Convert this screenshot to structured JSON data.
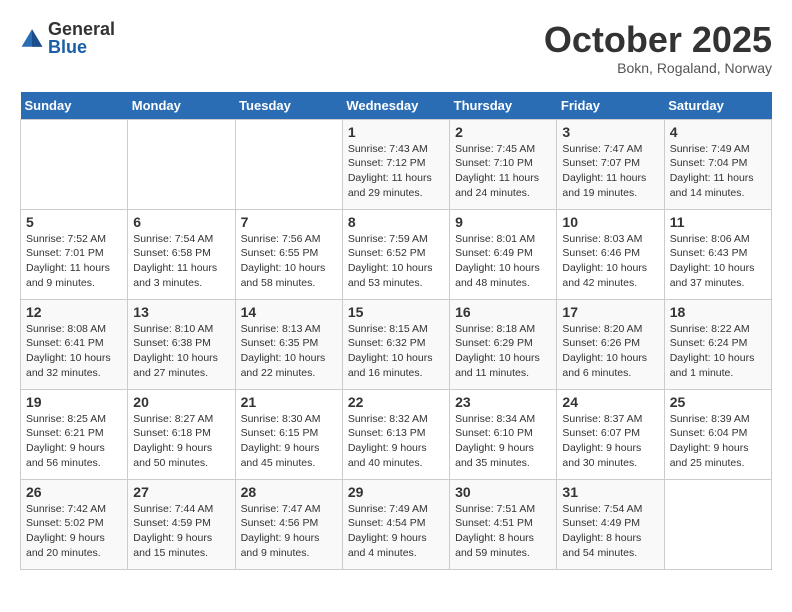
{
  "header": {
    "logo_general": "General",
    "logo_blue": "Blue",
    "month_year": "October 2025",
    "location": "Bokn, Rogaland, Norway"
  },
  "days_of_week": [
    "Sunday",
    "Monday",
    "Tuesday",
    "Wednesday",
    "Thursday",
    "Friday",
    "Saturday"
  ],
  "weeks": [
    [
      {
        "day": "",
        "info": ""
      },
      {
        "day": "",
        "info": ""
      },
      {
        "day": "",
        "info": ""
      },
      {
        "day": "1",
        "info": "Sunrise: 7:43 AM\nSunset: 7:12 PM\nDaylight: 11 hours\nand 29 minutes."
      },
      {
        "day": "2",
        "info": "Sunrise: 7:45 AM\nSunset: 7:10 PM\nDaylight: 11 hours\nand 24 minutes."
      },
      {
        "day": "3",
        "info": "Sunrise: 7:47 AM\nSunset: 7:07 PM\nDaylight: 11 hours\nand 19 minutes."
      },
      {
        "day": "4",
        "info": "Sunrise: 7:49 AM\nSunset: 7:04 PM\nDaylight: 11 hours\nand 14 minutes."
      }
    ],
    [
      {
        "day": "5",
        "info": "Sunrise: 7:52 AM\nSunset: 7:01 PM\nDaylight: 11 hours\nand 9 minutes."
      },
      {
        "day": "6",
        "info": "Sunrise: 7:54 AM\nSunset: 6:58 PM\nDaylight: 11 hours\nand 3 minutes."
      },
      {
        "day": "7",
        "info": "Sunrise: 7:56 AM\nSunset: 6:55 PM\nDaylight: 10 hours\nand 58 minutes."
      },
      {
        "day": "8",
        "info": "Sunrise: 7:59 AM\nSunset: 6:52 PM\nDaylight: 10 hours\nand 53 minutes."
      },
      {
        "day": "9",
        "info": "Sunrise: 8:01 AM\nSunset: 6:49 PM\nDaylight: 10 hours\nand 48 minutes."
      },
      {
        "day": "10",
        "info": "Sunrise: 8:03 AM\nSunset: 6:46 PM\nDaylight: 10 hours\nand 42 minutes."
      },
      {
        "day": "11",
        "info": "Sunrise: 8:06 AM\nSunset: 6:43 PM\nDaylight: 10 hours\nand 37 minutes."
      }
    ],
    [
      {
        "day": "12",
        "info": "Sunrise: 8:08 AM\nSunset: 6:41 PM\nDaylight: 10 hours\nand 32 minutes."
      },
      {
        "day": "13",
        "info": "Sunrise: 8:10 AM\nSunset: 6:38 PM\nDaylight: 10 hours\nand 27 minutes."
      },
      {
        "day": "14",
        "info": "Sunrise: 8:13 AM\nSunset: 6:35 PM\nDaylight: 10 hours\nand 22 minutes."
      },
      {
        "day": "15",
        "info": "Sunrise: 8:15 AM\nSunset: 6:32 PM\nDaylight: 10 hours\nand 16 minutes."
      },
      {
        "day": "16",
        "info": "Sunrise: 8:18 AM\nSunset: 6:29 PM\nDaylight: 10 hours\nand 11 minutes."
      },
      {
        "day": "17",
        "info": "Sunrise: 8:20 AM\nSunset: 6:26 PM\nDaylight: 10 hours\nand 6 minutes."
      },
      {
        "day": "18",
        "info": "Sunrise: 8:22 AM\nSunset: 6:24 PM\nDaylight: 10 hours\nand 1 minute."
      }
    ],
    [
      {
        "day": "19",
        "info": "Sunrise: 8:25 AM\nSunset: 6:21 PM\nDaylight: 9 hours\nand 56 minutes."
      },
      {
        "day": "20",
        "info": "Sunrise: 8:27 AM\nSunset: 6:18 PM\nDaylight: 9 hours\nand 50 minutes."
      },
      {
        "day": "21",
        "info": "Sunrise: 8:30 AM\nSunset: 6:15 PM\nDaylight: 9 hours\nand 45 minutes."
      },
      {
        "day": "22",
        "info": "Sunrise: 8:32 AM\nSunset: 6:13 PM\nDaylight: 9 hours\nand 40 minutes."
      },
      {
        "day": "23",
        "info": "Sunrise: 8:34 AM\nSunset: 6:10 PM\nDaylight: 9 hours\nand 35 minutes."
      },
      {
        "day": "24",
        "info": "Sunrise: 8:37 AM\nSunset: 6:07 PM\nDaylight: 9 hours\nand 30 minutes."
      },
      {
        "day": "25",
        "info": "Sunrise: 8:39 AM\nSunset: 6:04 PM\nDaylight: 9 hours\nand 25 minutes."
      }
    ],
    [
      {
        "day": "26",
        "info": "Sunrise: 7:42 AM\nSunset: 5:02 PM\nDaylight: 9 hours\nand 20 minutes."
      },
      {
        "day": "27",
        "info": "Sunrise: 7:44 AM\nSunset: 4:59 PM\nDaylight: 9 hours\nand 15 minutes."
      },
      {
        "day": "28",
        "info": "Sunrise: 7:47 AM\nSunset: 4:56 PM\nDaylight: 9 hours\nand 9 minutes."
      },
      {
        "day": "29",
        "info": "Sunrise: 7:49 AM\nSunset: 4:54 PM\nDaylight: 9 hours\nand 4 minutes."
      },
      {
        "day": "30",
        "info": "Sunrise: 7:51 AM\nSunset: 4:51 PM\nDaylight: 8 hours\nand 59 minutes."
      },
      {
        "day": "31",
        "info": "Sunrise: 7:54 AM\nSunset: 4:49 PM\nDaylight: 8 hours\nand 54 minutes."
      },
      {
        "day": "",
        "info": ""
      }
    ]
  ]
}
